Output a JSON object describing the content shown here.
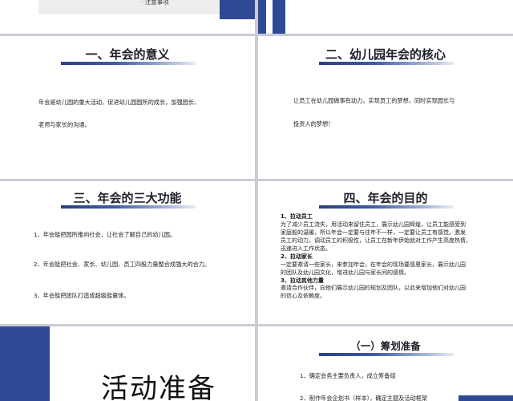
{
  "slide_top_left": {
    "bullet": "· 注意事项"
  },
  "slide_meaning": {
    "title": "一、年会的意义",
    "lines": [
      "年会是幼儿园的重大活动，促进幼儿园园所的成长，加强园长、",
      "老师与家长的沟通。"
    ]
  },
  "slide_core": {
    "title": "二、幼儿园年会的核心",
    "lines": [
      "让员工在幼儿园做事有动力，实现员工的梦想，同时实现园长与",
      "投资人的梦想！"
    ]
  },
  "slide_functions": {
    "title": "三、年会的三大功能",
    "items": [
      "1、年会能把园所推向社会，让社会了解自己的幼儿园。",
      "2、年会能把社会、家长、幼儿园、员工四股力量整合成强大的合力。",
      "3、年会能把团队打造成超级能量体。"
    ]
  },
  "slide_purpose": {
    "title": "四、年会的目的",
    "sections": [
      {
        "head": "1、拉动员工",
        "lines": [
          "为了减少员工流失，用活动来留住员工，展示幼儿园辉煌，让员工能感受到",
          "家庭般的温暖，所以年会一定要与往年不一样，一定要让员工有感觉。激发",
          "员工的动力，调动员工的积极性，让员工在新年伊始就对工作产生高度热情，",
          "迅速进入工作状态。"
        ]
      },
      {
        "head": "2、拉动家长",
        "lines": [
          "一定要邀请一些家长，来参加年会，在年会的现场要感恩家长，展示幼儿园",
          "的团队及幼儿园文化，增进幼儿园与家长间的感情。"
        ]
      },
      {
        "head": "3、拉动其他力量",
        "lines": [
          "邀请合作伙伴，向他们展示幼儿园的规划及团队，以此来增加他们对幼儿园",
          "的信心及依赖度。"
        ]
      }
    ]
  },
  "slide_activity": {
    "title": "活动准备"
  },
  "slide_planning": {
    "title": "（一）筹划准备",
    "items": [
      "1、确定会务主要负责人，成立筹备组",
      "2、制作年会企划书（样本），确定主题及活动框架"
    ]
  }
}
